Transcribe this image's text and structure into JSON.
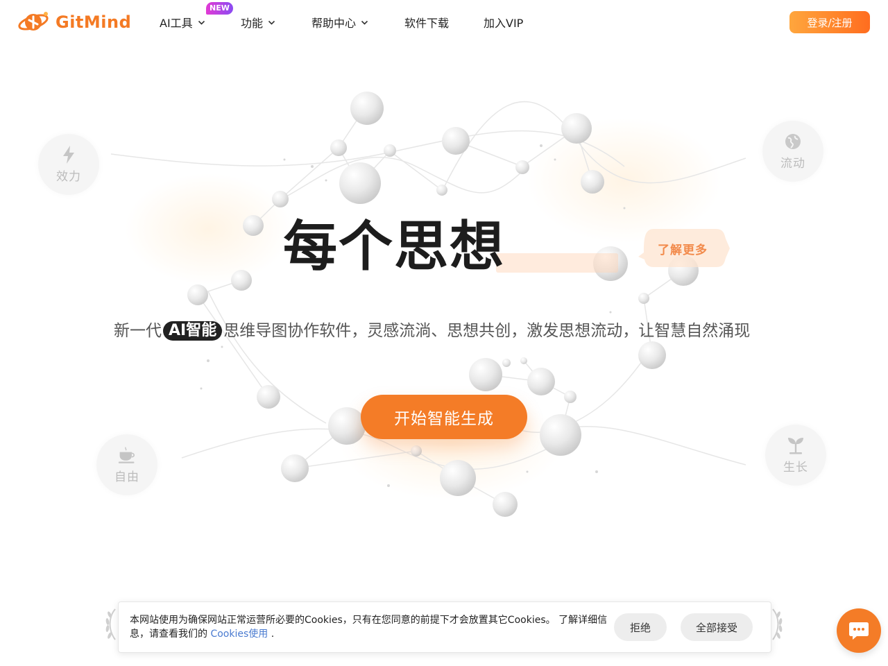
{
  "brand": {
    "name": "GitMind",
    "color": "#f47a24"
  },
  "nav": {
    "items": [
      {
        "label": "AI工具",
        "has_dropdown": true
      },
      {
        "label": "功能",
        "has_dropdown": true
      },
      {
        "label": "帮助中心",
        "has_dropdown": true
      },
      {
        "label": "软件下载",
        "has_dropdown": false
      },
      {
        "label": "加入VIP",
        "has_dropdown": false
      }
    ],
    "new_badge": "NEW"
  },
  "header": {
    "login_label": "登录/注册"
  },
  "hero": {
    "title": "每个思想",
    "learn_more": "了解更多",
    "subtitle_prefix": "新一代",
    "subtitle_chip": "AI智能",
    "subtitle_suffix": "思维导图协作软件，灵感流淌、思想共创，激发思想流动，让智慧自然涌现",
    "cta_label": "开始智能生成",
    "accent": "#f47c27"
  },
  "features": [
    {
      "label": "效力",
      "icon": "lightning-icon"
    },
    {
      "label": "流动",
      "icon": "globe-icon"
    },
    {
      "label": "自由",
      "icon": "coffee-cup-icon"
    },
    {
      "label": "生长",
      "icon": "sprout-icon"
    }
  ],
  "cookie": {
    "text_main": "本网站使用为确保网站正常运营所必要的Cookies，只有在您同意的前提下才会放置其它Cookies。 了解详细信息，请查看我们的 ",
    "link_label": "Cookies使用",
    "text_end": " .",
    "reject_label": "拒绝",
    "accept_label": "全部接受"
  },
  "chat": {
    "icon": "chat-bubble-icon"
  }
}
